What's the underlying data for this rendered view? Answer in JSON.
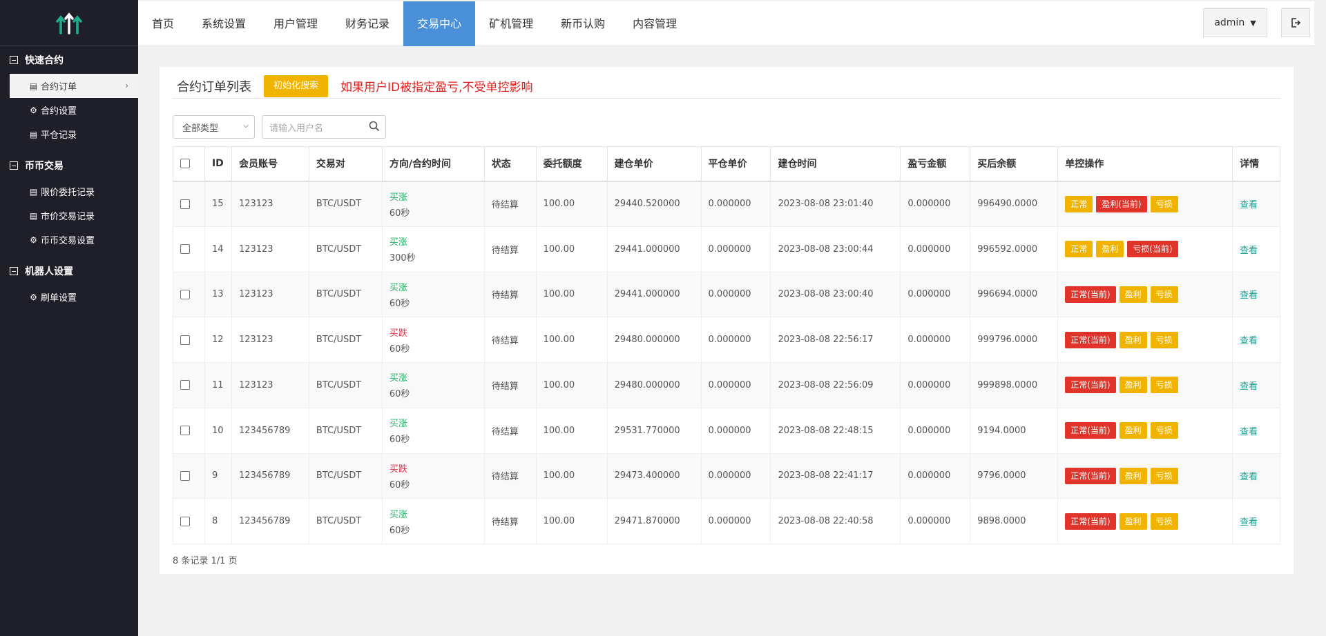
{
  "sidebar": {
    "groups": [
      {
        "title": "快速合约",
        "items": [
          {
            "label": "合约订单",
            "icon": "table-icon",
            "active": true
          },
          {
            "label": "合约设置",
            "icon": "gear-icon"
          },
          {
            "label": "平仓记录",
            "icon": "table-icon"
          }
        ]
      },
      {
        "title": "币币交易",
        "items": [
          {
            "label": "限价委托记录",
            "icon": "table-icon"
          },
          {
            "label": "市价交易记录",
            "icon": "table-icon"
          },
          {
            "label": "币币交易设置",
            "icon": "gear-icon"
          }
        ]
      },
      {
        "title": "机器人设置",
        "items": [
          {
            "label": "刷单设置",
            "icon": "gear-icon"
          }
        ]
      }
    ]
  },
  "topnav": {
    "tabs": [
      "首页",
      "系统设置",
      "用户管理",
      "财务记录",
      "交易中心",
      "矿机管理",
      "新币认购",
      "内容管理"
    ],
    "active_index": 4,
    "user": "admin"
  },
  "panel": {
    "title": "合约订单列表",
    "init_button": "初始化搜索",
    "warning": "如果用户ID被指定盈亏,不受单控影响"
  },
  "filters": {
    "type_select": "全部类型",
    "search_placeholder": "请输入用户名"
  },
  "table": {
    "headers": [
      "ID",
      "会员账号",
      "交易对",
      "方向/合约时间",
      "状态",
      "委托额度",
      "建仓单价",
      "平仓单价",
      "建仓时间",
      "盈亏金额",
      "买后余额",
      "单控操作",
      "详情"
    ],
    "rows": [
      {
        "id": "15",
        "account": "123123",
        "pair": "BTC/USDT",
        "dir": "买涨",
        "dir_type": "up",
        "period": "60秒",
        "status": "待结算",
        "amount": "100.00",
        "open": "29440.520000",
        "close": "0.000000",
        "time": "2023-08-08 23:01:40",
        "pnl": "0.000000",
        "balance": "996490.0000",
        "ops": [
          {
            "label": "正常",
            "c": "y"
          },
          {
            "label": "盈利(当前)",
            "c": "r"
          },
          {
            "label": "亏损",
            "c": "y"
          }
        ],
        "view": "查看"
      },
      {
        "id": "14",
        "account": "123123",
        "pair": "BTC/USDT",
        "dir": "买涨",
        "dir_type": "up",
        "period": "300秒",
        "status": "待结算",
        "amount": "100.00",
        "open": "29441.000000",
        "close": "0.000000",
        "time": "2023-08-08 23:00:44",
        "pnl": "0.000000",
        "balance": "996592.0000",
        "ops": [
          {
            "label": "正常",
            "c": "y"
          },
          {
            "label": "盈利",
            "c": "y"
          },
          {
            "label": "亏损(当前)",
            "c": "r"
          }
        ],
        "view": "查看"
      },
      {
        "id": "13",
        "account": "123123",
        "pair": "BTC/USDT",
        "dir": "买涨",
        "dir_type": "up",
        "period": "60秒",
        "status": "待结算",
        "amount": "100.00",
        "open": "29441.000000",
        "close": "0.000000",
        "time": "2023-08-08 23:00:40",
        "pnl": "0.000000",
        "balance": "996694.0000",
        "ops": [
          {
            "label": "正常(当前)",
            "c": "r"
          },
          {
            "label": "盈利",
            "c": "y"
          },
          {
            "label": "亏损",
            "c": "y"
          }
        ],
        "view": "查看"
      },
      {
        "id": "12",
        "account": "123123",
        "pair": "BTC/USDT",
        "dir": "买跌",
        "dir_type": "down",
        "period": "60秒",
        "status": "待结算",
        "amount": "100.00",
        "open": "29480.000000",
        "close": "0.000000",
        "time": "2023-08-08 22:56:17",
        "pnl": "0.000000",
        "balance": "999796.0000",
        "ops": [
          {
            "label": "正常(当前)",
            "c": "r"
          },
          {
            "label": "盈利",
            "c": "y"
          },
          {
            "label": "亏损",
            "c": "y"
          }
        ],
        "view": "查看"
      },
      {
        "id": "11",
        "account": "123123",
        "pair": "BTC/USDT",
        "dir": "买涨",
        "dir_type": "up",
        "period": "60秒",
        "status": "待结算",
        "amount": "100.00",
        "open": "29480.000000",
        "close": "0.000000",
        "time": "2023-08-08 22:56:09",
        "pnl": "0.000000",
        "balance": "999898.0000",
        "ops": [
          {
            "label": "正常(当前)",
            "c": "r"
          },
          {
            "label": "盈利",
            "c": "y"
          },
          {
            "label": "亏损",
            "c": "y"
          }
        ],
        "view": "查看"
      },
      {
        "id": "10",
        "account": "123456789",
        "pair": "BTC/USDT",
        "dir": "买涨",
        "dir_type": "up",
        "period": "60秒",
        "status": "待结算",
        "amount": "100.00",
        "open": "29531.770000",
        "close": "0.000000",
        "time": "2023-08-08 22:48:15",
        "pnl": "0.000000",
        "balance": "9194.0000",
        "ops": [
          {
            "label": "正常(当前)",
            "c": "r"
          },
          {
            "label": "盈利",
            "c": "y"
          },
          {
            "label": "亏损",
            "c": "y"
          }
        ],
        "view": "查看"
      },
      {
        "id": "9",
        "account": "123456789",
        "pair": "BTC/USDT",
        "dir": "买跌",
        "dir_type": "down",
        "period": "60秒",
        "status": "待结算",
        "amount": "100.00",
        "open": "29473.400000",
        "close": "0.000000",
        "time": "2023-08-08 22:41:17",
        "pnl": "0.000000",
        "balance": "9796.0000",
        "ops": [
          {
            "label": "正常(当前)",
            "c": "r"
          },
          {
            "label": "盈利",
            "c": "y"
          },
          {
            "label": "亏损",
            "c": "y"
          }
        ],
        "view": "查看"
      },
      {
        "id": "8",
        "account": "123456789",
        "pair": "BTC/USDT",
        "dir": "买涨",
        "dir_type": "up",
        "period": "60秒",
        "status": "待结算",
        "amount": "100.00",
        "open": "29471.870000",
        "close": "0.000000",
        "time": "2023-08-08 22:40:58",
        "pnl": "0.000000",
        "balance": "9898.0000",
        "ops": [
          {
            "label": "正常(当前)",
            "c": "r"
          },
          {
            "label": "盈利",
            "c": "y"
          },
          {
            "label": "亏损",
            "c": "y"
          }
        ],
        "view": "查看"
      }
    ]
  },
  "footer": {
    "count": "8 条记录 1/1 页"
  },
  "colors": {
    "sidebar_bg": "#1f1f29",
    "active_tab": "#4a90d9",
    "accent_yellow": "#f0b400",
    "accent_red": "#e0342b",
    "up_green": "#29b06a",
    "down_red": "#e0344b",
    "link": "#1aa094"
  }
}
